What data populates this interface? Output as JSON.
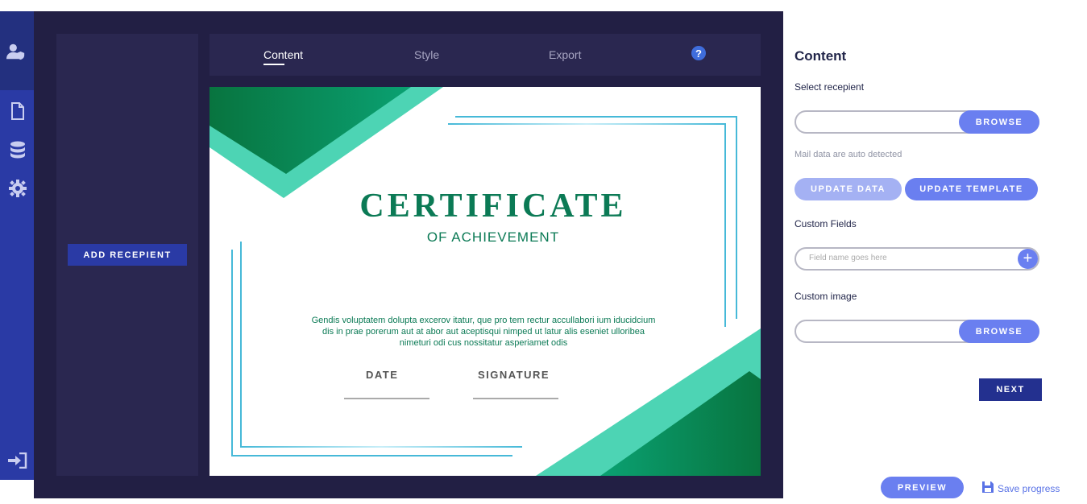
{
  "tabs": [
    {
      "label": "Content"
    },
    {
      "label": "Style"
    },
    {
      "label": "Export"
    }
  ],
  "help_label": "?",
  "left_panel": {
    "add_button": "ADD RECEPIENT"
  },
  "certificate": {
    "title": "CERTIFICATE",
    "subtitle": "OF ACHIEVEMENT",
    "body": "Gendis voluptatem dolupta excerov itatur, que pro tem rectur accullabori ium iducidcium dis in prae porerum aut at abor aut aceptisqui nimped ut latur alis eseniet ulloribea nimeturi odi cus nossitatur asperiamet odis",
    "date_label": "DATE",
    "signature_label": "SIGNATURE"
  },
  "side": {
    "heading": "Content",
    "select_recipient_label": "Select recepient",
    "browse_label": "BROWSE",
    "mail_hint": "Mail data are auto detected",
    "update_data": "UPDATE DATA",
    "update_template": "UPDATE TEMPLATE",
    "custom_fields_label": "Custom Fields",
    "field_placeholder": "Field name goes here",
    "plus": "+",
    "custom_image_label": "Custom image",
    "next": "NEXT",
    "preview": "PREVIEW",
    "save_progress": "Save progress"
  },
  "icons": [
    "user-shield-icon",
    "document-icon",
    "database-icon",
    "gear-icon",
    "sign-in-icon",
    "save-icon"
  ],
  "colors": {
    "rail": "#2a3aa5",
    "workspace": "#221f44",
    "accent": "#6a7ff0",
    "cert_green": "#0b7a55",
    "cert_teal": "#4dd4b4"
  }
}
